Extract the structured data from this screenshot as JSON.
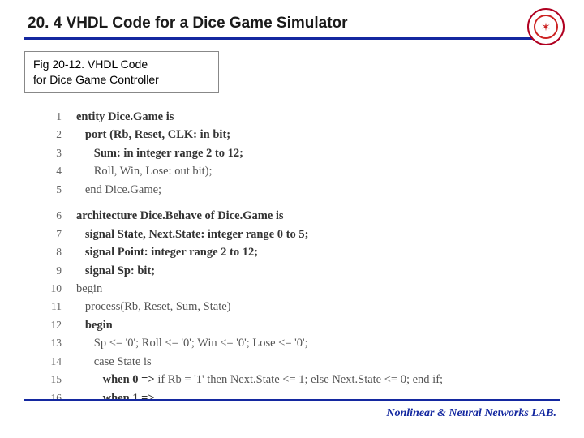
{
  "header": {
    "title": "20. 4 VHDL Code for a Dice Game Simulator",
    "logo_name": "university-emblem"
  },
  "caption": {
    "line1": "Fig 20-12. VHDL Code",
    "line2": "for Dice Game Controller"
  },
  "code": [
    {
      "n": "1",
      "indent": 0,
      "t": "entity Dice.Game is",
      "bold": true
    },
    {
      "n": "2",
      "indent": 1,
      "t": "port (Rb, Reset, CLK: in bit;",
      "bold": true
    },
    {
      "n": "3",
      "indent": 2,
      "t": "Sum: in integer range 2 to 12;",
      "bold": true
    },
    {
      "n": "4",
      "indent": 2,
      "t": "Roll, Win, Lose: out bit);",
      "bold": false
    },
    {
      "n": "5",
      "indent": 1,
      "t": "end Dice.Game;",
      "bold": false
    },
    {
      "n": "6",
      "indent": 0,
      "t": "architecture Dice.Behave of Dice.Game is",
      "bold": true,
      "gap": true
    },
    {
      "n": "7",
      "indent": 1,
      "t": "signal State, Next.State: integer range 0 to 5;",
      "bold": true
    },
    {
      "n": "8",
      "indent": 1,
      "t": "signal Point: integer range 2 to 12;",
      "bold": true
    },
    {
      "n": "9",
      "indent": 1,
      "t": "signal Sp: bit;",
      "bold": true
    },
    {
      "n": "10",
      "indent": 0,
      "t": "begin",
      "bold": false
    },
    {
      "n": "11",
      "indent": 1,
      "t": "process(Rb, Reset, Sum, State)",
      "bold": false
    },
    {
      "n": "12",
      "indent": 1,
      "t": "begin",
      "bold": true
    },
    {
      "n": "13",
      "indent": 2,
      "t": "Sp <= '0'; Roll <= '0'; Win <= '0'; Lose <= '0';",
      "bold": false
    },
    {
      "n": "14",
      "indent": 2,
      "t": "case State is",
      "bold": false
    },
    {
      "n": "15",
      "indent": 3,
      "t": "when 0 => if Rb = '1' then Next.State <= 1; else Next.State <= 0; end if;",
      "bold": false,
      "boldWhen": true
    },
    {
      "n": "16",
      "indent": 3,
      "t": "when 1 =>",
      "bold": false,
      "boldWhen": true
    }
  ],
  "footer": "Nonlinear & Neural Networks LAB."
}
